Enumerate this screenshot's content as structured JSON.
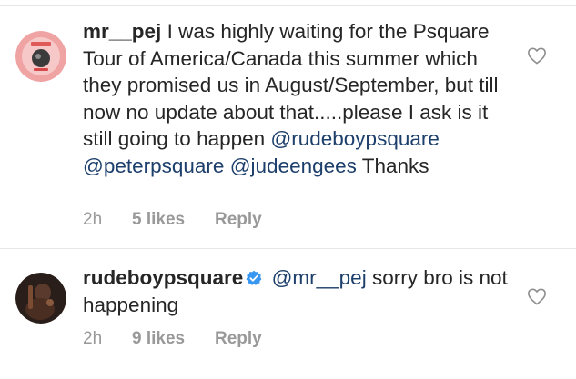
{
  "comments": [
    {
      "username": "mr__pej",
      "text_parts": [
        {
          "type": "text",
          "value": " I was highly waiting for the Psquare Tour of America/Canada this summer which they promised us in August/September, but till now no update about that.....please I ask is it still going  to happen "
        },
        {
          "type": "mention",
          "value": "@rudeboypsquare"
        },
        {
          "type": "text",
          "value": " "
        },
        {
          "type": "mention",
          "value": "@peterpsquare"
        },
        {
          "type": "text",
          "value": " "
        },
        {
          "type": "mention",
          "value": "@judeengees"
        },
        {
          "type": "text",
          "value": " Thanks"
        }
      ],
      "time": "2h",
      "likes": "5 likes",
      "reply": "Reply",
      "verified": false,
      "avatar_icon": "avatar-icon",
      "like_icon": "heart-outline-icon"
    },
    {
      "username": "rudeboypsquare",
      "text_parts": [
        {
          "type": "mention",
          "value": "@mr__pej"
        },
        {
          "type": "text",
          "value": " sorry bro is not happening"
        }
      ],
      "time": "2h",
      "likes": "9 likes",
      "reply": "Reply",
      "verified": true,
      "verified_icon": "verified-badge-icon",
      "avatar_icon": "avatar-icon",
      "like_icon": "heart-outline-icon"
    }
  ],
  "colors": {
    "text": "#262626",
    "mention": "#1d3f6b",
    "meta": "#999999",
    "verified": "#3897f0",
    "divider": "#e6e6e6"
  }
}
